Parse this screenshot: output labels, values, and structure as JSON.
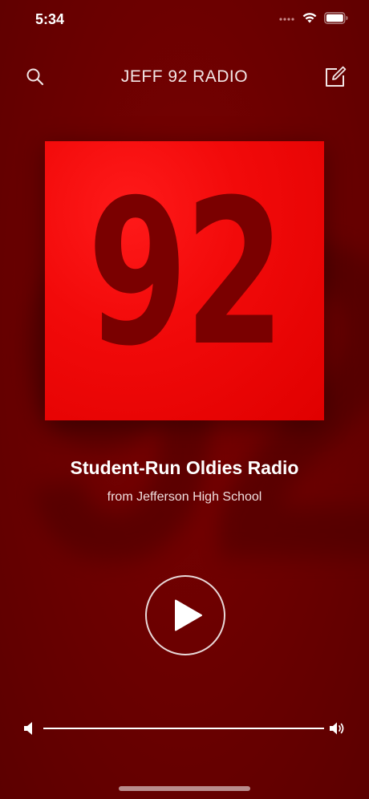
{
  "status_bar": {
    "time": "5:34",
    "icons": [
      "signal-dots-icon",
      "wifi-icon",
      "battery-icon"
    ]
  },
  "nav": {
    "title": "JEFF 92 RADIO",
    "left_icon": "search-icon",
    "right_icon": "compose-icon"
  },
  "artwork": {
    "numeral": "92",
    "background_color": "#ee0808",
    "numeral_color": "#7a0000"
  },
  "background": {
    "numeral": "92",
    "color": "#6a0000"
  },
  "station": {
    "title": "Student-Run Oldies Radio",
    "subtitle": "from Jefferson High School"
  },
  "player": {
    "play_icon": "play-icon",
    "state": "paused"
  },
  "volume": {
    "low_icon": "volume-low-icon",
    "high_icon": "volume-high-icon",
    "level": 1.0
  },
  "colors": {
    "accent": "#ff0000",
    "background": "#6a0000",
    "text": "#ffffff"
  }
}
